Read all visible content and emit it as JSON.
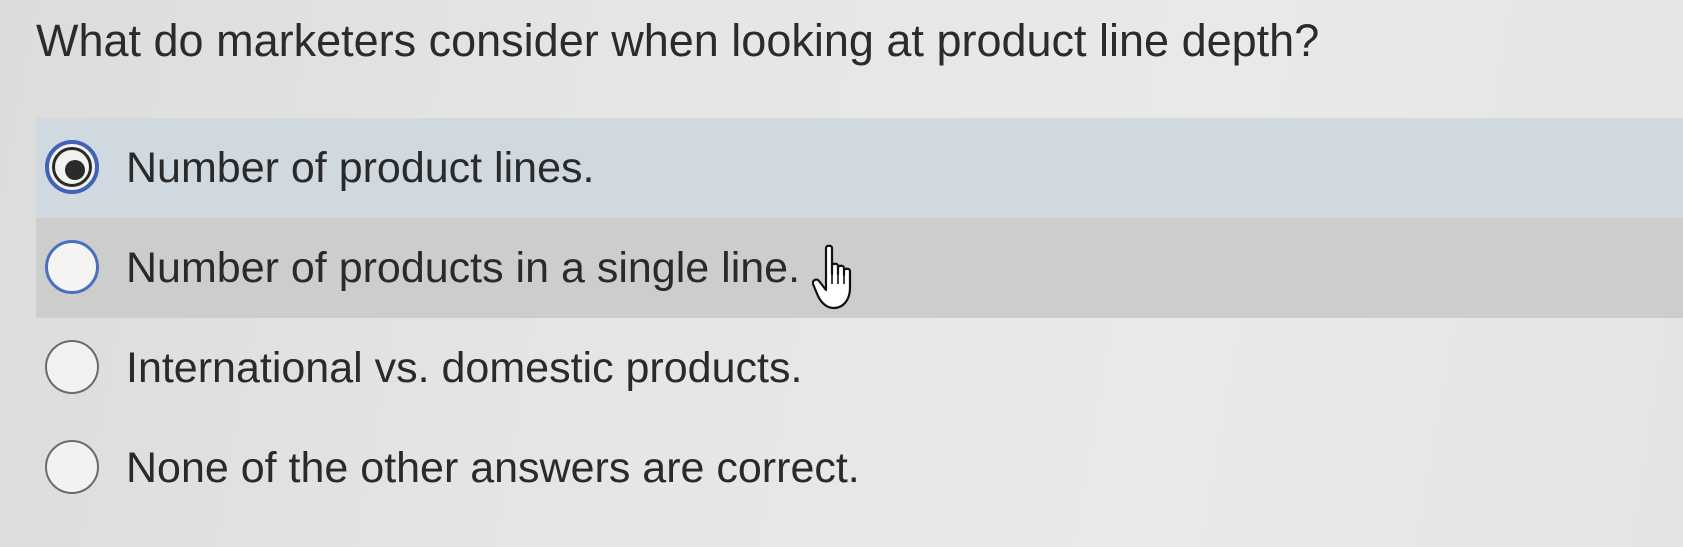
{
  "question": {
    "text": "What do marketers consider when looking at product line depth?"
  },
  "options": [
    {
      "label": "Number of product lines.",
      "state": "selected"
    },
    {
      "label": "Number of products in a single line.",
      "state": "hovered"
    },
    {
      "label": "International vs. domestic products.",
      "state": "default"
    },
    {
      "label": "None of the other answers are correct.",
      "state": "default"
    }
  ],
  "colors": {
    "selected_row": "#d0d8e0",
    "hovered_row": "#cdcdcb",
    "focus_ring": "#3f63b8",
    "text": "#2a2a2a"
  },
  "icons": {
    "cursor": "pointing-hand-cursor-icon"
  }
}
